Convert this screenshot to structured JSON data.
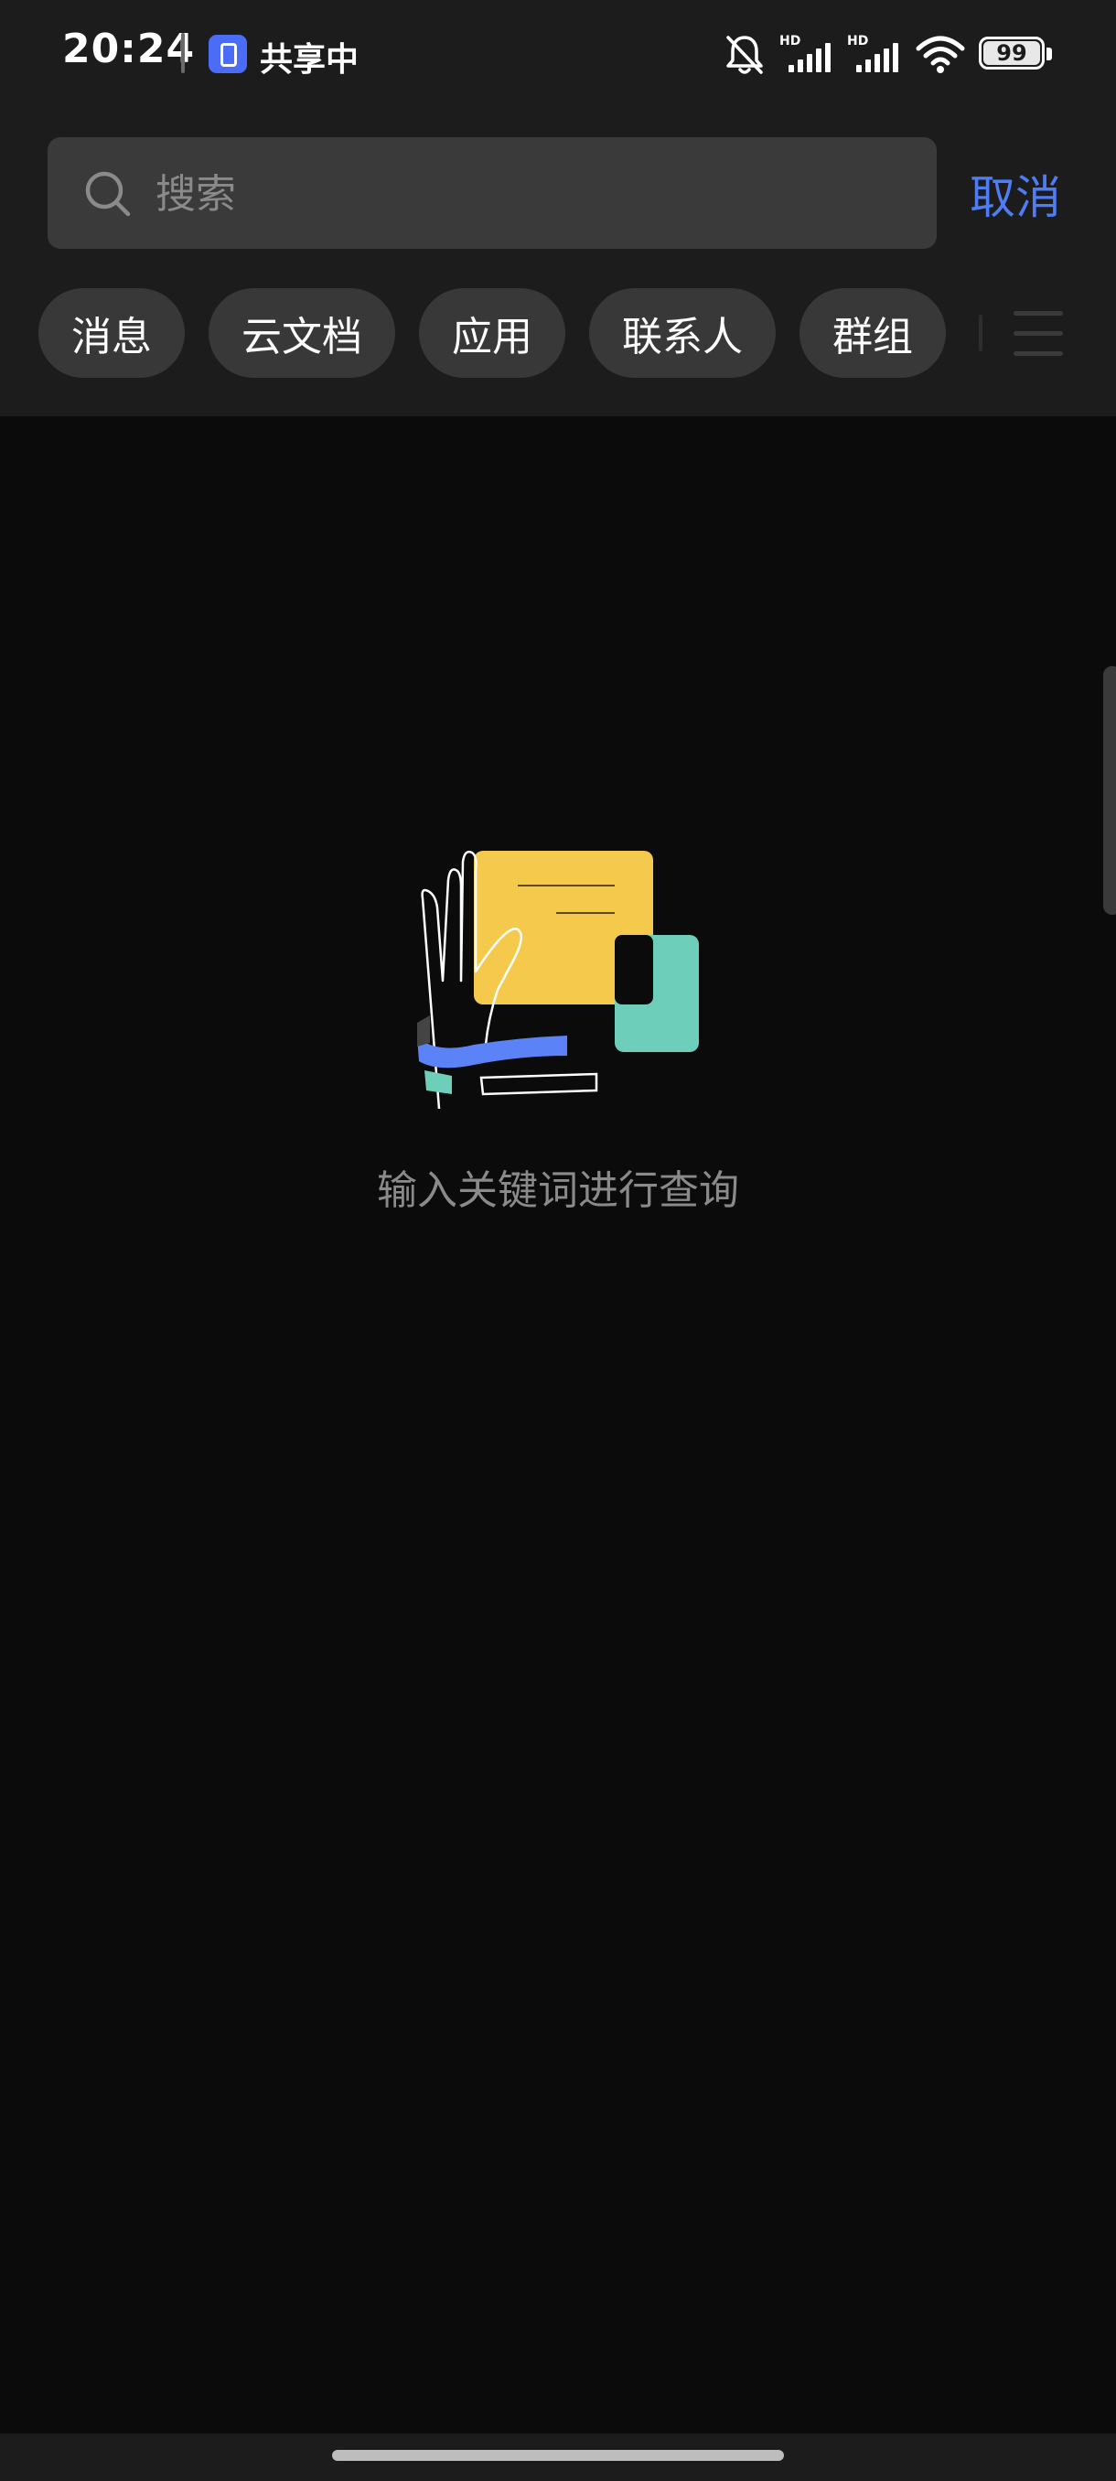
{
  "status_bar": {
    "time": "20:24",
    "share_label": "共享中",
    "battery_level": "99",
    "icons": [
      "share-app-icon",
      "bell-muted-icon",
      "hd-signal-icon",
      "hd-signal-icon",
      "wifi-icon",
      "battery-icon"
    ]
  },
  "search": {
    "placeholder": "搜索",
    "value": "",
    "cancel_label": "取消"
  },
  "filters": {
    "chips": [
      {
        "label": "消息"
      },
      {
        "label": "云文档"
      },
      {
        "label": "应用"
      },
      {
        "label": "联系人"
      },
      {
        "label": "群组"
      }
    ],
    "menu_icon": "menu-icon"
  },
  "empty_state": {
    "illustration": "hand-document-illustration",
    "hint": "输入关键词进行查询"
  },
  "colors": {
    "accent": "#4d7cf5",
    "background": "#0b0b0b",
    "header_background": "#1c1c1c",
    "chip_background": "#383838",
    "illustration_yellow": "#f5c94c",
    "illustration_teal": "#6dcfba",
    "illustration_blue": "#5b83f7"
  }
}
